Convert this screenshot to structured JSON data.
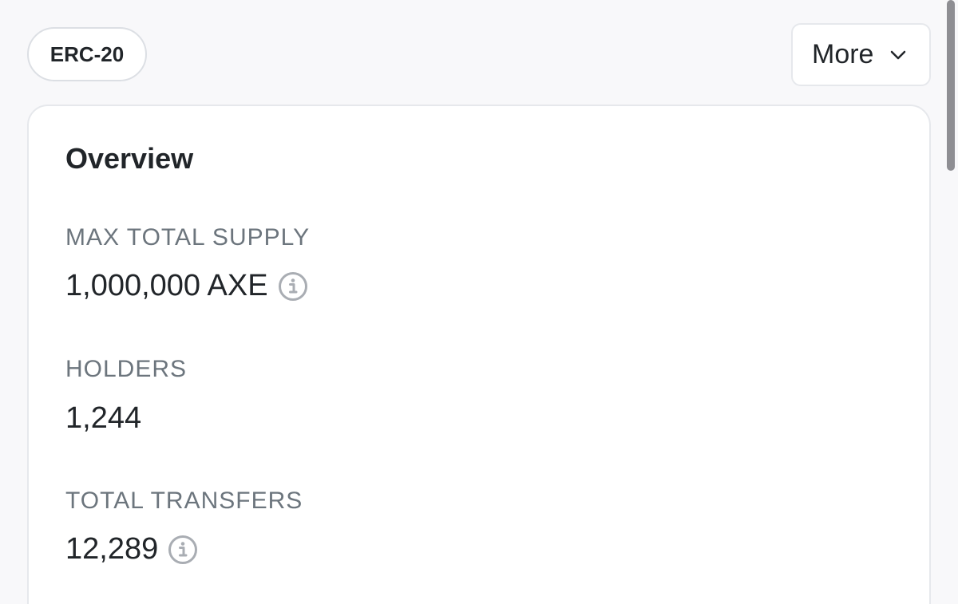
{
  "header": {
    "token_standard_badge": "ERC-20",
    "more_button_label": "More"
  },
  "overview": {
    "title": "Overview",
    "fields": [
      {
        "label": "MAX TOTAL SUPPLY",
        "value": "1,000,000 AXE",
        "has_info_icon": true
      },
      {
        "label": "HOLDERS",
        "value": "1,244",
        "has_info_icon": false
      },
      {
        "label": "TOTAL TRANSFERS",
        "value": "12,289",
        "has_info_icon": true
      }
    ]
  },
  "icons": {
    "more_chevron": "chevron-down-icon",
    "info": "info-circle-icon"
  },
  "colors": {
    "background": "#f8f8fa",
    "card": "#ffffff",
    "label_gray": "#6c757d",
    "text_dark": "#212529"
  }
}
